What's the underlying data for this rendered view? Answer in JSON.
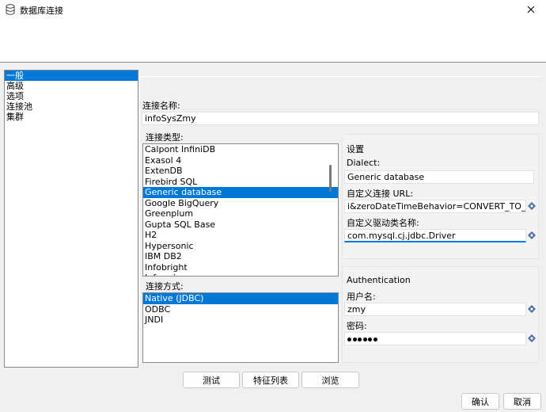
{
  "window": {
    "title": "数据库连接"
  },
  "nav": {
    "items": [
      {
        "label": "一般",
        "selected": true
      },
      {
        "label": "高级"
      },
      {
        "label": "选项"
      },
      {
        "label": "连接池"
      },
      {
        "label": "集群"
      }
    ]
  },
  "connection": {
    "name_label": "连接名称:",
    "name_value": "infoSysZmy",
    "type_label": "连接类型:",
    "types": [
      "Calpont InfiniDB",
      "Exasol 4",
      "ExtenDB",
      "Firebird SQL",
      "Generic database",
      "Google BigQuery",
      "Greenplum",
      "Gupta SQL Base",
      "H2",
      "Hypersonic",
      "IBM DB2",
      "Infobright",
      "Informix"
    ],
    "selected_type_index": 4,
    "method_label": "连接方式:",
    "methods": [
      "Native (JDBC)",
      "ODBC",
      "JNDI"
    ],
    "selected_method_index": 0
  },
  "settings": {
    "title": "设置",
    "dialect_label": "Dialect:",
    "dialect_value": "Generic database",
    "url_label": "自定义连接 URL:",
    "url_value": "i&zeroDateTimeBehavior=CONVERT_TO_NULL",
    "driver_label": "自定义驱动类名称:",
    "driver_value": "com.mysql.cj.jdbc.Driver"
  },
  "auth": {
    "title": "Authentication",
    "user_label": "用户名:",
    "user_value": "zmy",
    "password_label": "密码:",
    "password_dots": 6
  },
  "buttons": {
    "test": "测试",
    "features": "特征列表",
    "browse": "浏览",
    "ok": "确认",
    "cancel": "取消"
  },
  "colors": {
    "selection": "#0078d7",
    "accent": "#0078d7"
  },
  "icons": {
    "app": "database-icon",
    "close": "close-icon",
    "var": "variable-diamond-icon"
  }
}
